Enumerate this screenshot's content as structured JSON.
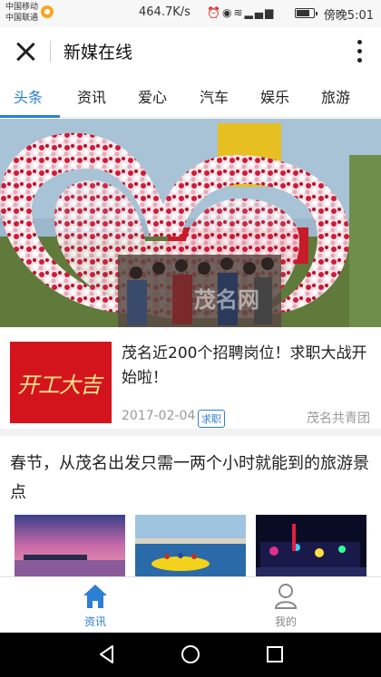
{
  "status_bar": {
    "carrier1": "中国移动",
    "carrier2": "中国联通",
    "speed": "464.7K/s",
    "time": "傍晚5:01",
    "battery_level": 0.85
  },
  "header": {
    "title": "新媒在线"
  },
  "tabs": [
    {
      "label": "头条",
      "active": true
    },
    {
      "label": "资讯",
      "active": false
    },
    {
      "label": "爱心",
      "active": false
    },
    {
      "label": "汽车",
      "active": false
    },
    {
      "label": "娱乐",
      "active": false
    },
    {
      "label": "旅游",
      "active": false
    }
  ],
  "banner": {
    "watermark": "茂名网"
  },
  "article1": {
    "thumb_text": "开工大吉",
    "title": "茂名近200个招聘岗位！求职大战开始啦！",
    "date": "2017-02-04",
    "tag": "求职",
    "source": "茂名共青团"
  },
  "article2": {
    "title": "春节，从茂名出发只需一两个小时就能到的旅游景点"
  },
  "bottom_nav": [
    {
      "label": "资讯",
      "icon": "home-icon",
      "active": true
    },
    {
      "label": "我的",
      "icon": "person-icon",
      "active": false
    }
  ],
  "colors": {
    "accent": "#2b7fd4",
    "inactive": "#888888"
  }
}
